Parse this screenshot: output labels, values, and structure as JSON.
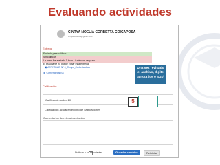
{
  "slide": {
    "title": "Evaluando actividades",
    "callout": [
      "Una vez revisado",
      "el archivo, digite",
      "la nota (de 0 a 20)"
    ],
    "grade_value": "5",
    "accent_color": "#c0392b",
    "callout_color": "#2a6e9c",
    "highlight_color": "#2f9a8e"
  },
  "moodle": {
    "user": {
      "name": "CINTYA NOELIA CORBETTA COICAPOSA",
      "email": "cintyacorbetta@gmail.com",
      "avatar_icon": "user-avatar-icon"
    },
    "submission_header": "Entrega",
    "rows": [
      {
        "text": "Enviado para calificar",
        "style": "green"
      },
      {
        "text": "Sin calificar",
        "style": "red"
      },
      {
        "text": "La tarea fue enviada 1 hora 14 minutos después",
        "style": "red"
      },
      {
        "text": "El estudiante no puede editar esta entrega",
        "style": "plain"
      }
    ],
    "file_link": "ACTIVIDAD N° 4_Cintya_Corbetta.docx",
    "file_icon": "file-icon",
    "comments_label": "Comentarios (0)",
    "grading_header": "Calificación",
    "grade_field_label": "Calificación sobre 20",
    "current_grade_label": "Calificación actual en el libro de calificaciones",
    "feedback_label": "Comentarios de retroalimentación",
    "notify_label": "Notificar a los estudiantes",
    "save_button": "Guardar cambios",
    "reset_button": "Reiniciar"
  }
}
